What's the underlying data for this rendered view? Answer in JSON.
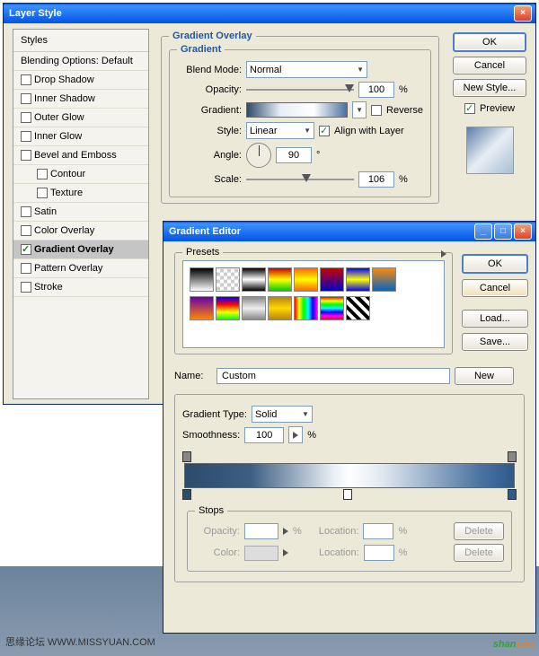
{
  "layerStyle": {
    "title": "Layer Style",
    "stylesHeader": "Styles",
    "blendingOptions": "Blending Options: Default",
    "items": [
      {
        "label": "Drop Shadow",
        "checked": false
      },
      {
        "label": "Inner Shadow",
        "checked": false
      },
      {
        "label": "Outer Glow",
        "checked": false
      },
      {
        "label": "Inner Glow",
        "checked": false
      },
      {
        "label": "Bevel and Emboss",
        "checked": false
      },
      {
        "label": "Contour",
        "checked": false,
        "sub": true
      },
      {
        "label": "Texture",
        "checked": false,
        "sub": true
      },
      {
        "label": "Satin",
        "checked": false
      },
      {
        "label": "Color Overlay",
        "checked": false
      },
      {
        "label": "Gradient Overlay",
        "checked": true,
        "selected": true
      },
      {
        "label": "Pattern Overlay",
        "checked": false
      },
      {
        "label": "Stroke",
        "checked": false
      }
    ],
    "sectionTitle": "Gradient Overlay",
    "gradientGroup": "Gradient",
    "blendModeLabel": "Blend Mode:",
    "blendMode": "Normal",
    "opacityLabel": "Opacity:",
    "opacity": "100",
    "gradientLabel": "Gradient:",
    "reverseLabel": "Reverse",
    "reverseChecked": false,
    "styleLabel": "Style:",
    "style": "Linear",
    "alignLabel": "Align with Layer",
    "alignChecked": true,
    "angleLabel": "Angle:",
    "angle": "90",
    "scaleLabel": "Scale:",
    "scale": "106",
    "percent": "%",
    "degree": "°",
    "okBtn": "OK",
    "cancelBtn": "Cancel",
    "newStyleBtn": "New Style...",
    "previewLabel": "Preview",
    "previewChecked": true
  },
  "gradientEditor": {
    "title": "Gradient Editor",
    "presetsLabel": "Presets",
    "nameLabel": "Name:",
    "name": "Custom",
    "newBtn": "New",
    "typeLabel": "Gradient Type:",
    "type": "Solid",
    "smoothLabel": "Smoothness:",
    "smoothness": "100",
    "percent": "%",
    "stopsLabel": "Stops",
    "stopOpacityLabel": "Opacity:",
    "stopLocationLabel": "Location:",
    "stopColorLabel": "Color:",
    "deleteBtn": "Delete",
    "okBtn": "OK",
    "cancelBtn": "Cancel",
    "loadBtn": "Load...",
    "saveBtn": "Save...",
    "presets": [
      "linear-gradient(#000,#fff)",
      "repeating-conic-gradient(#ccc 0 25%,#fff 0 50%) 0/8px 8px",
      "linear-gradient(#000,#fff,#000)",
      "linear-gradient(#c00,#ff0,#0c0)",
      "linear-gradient(#f60,#ff0,#f60)",
      "linear-gradient(#c00,#00c)",
      "linear-gradient(#00f,#ff0,#00f)",
      "linear-gradient(#f80,#06c)",
      "linear-gradient(#60a,#f80)",
      "linear-gradient(#00f,#f00,#ff0,#0f0)",
      "linear-gradient(#888,#eee,#888)",
      "linear-gradient(#b8860b,#ffd700,#b8860b)",
      "linear-gradient(90deg,#f00,#ff0,#0f0,#0ff,#00f,#f0f)",
      "linear-gradient(#f00,#ff0,#0f0,#0ff,#00f,#f0f,#f00)",
      "repeating-linear-gradient(45deg,#000 0 4px,#fff 4px 8px)"
    ]
  },
  "footer": {
    "text": "思缘论坛  WWW.MISSYUAN.COM",
    "logo1": "shan",
    "logo2": "cun"
  }
}
